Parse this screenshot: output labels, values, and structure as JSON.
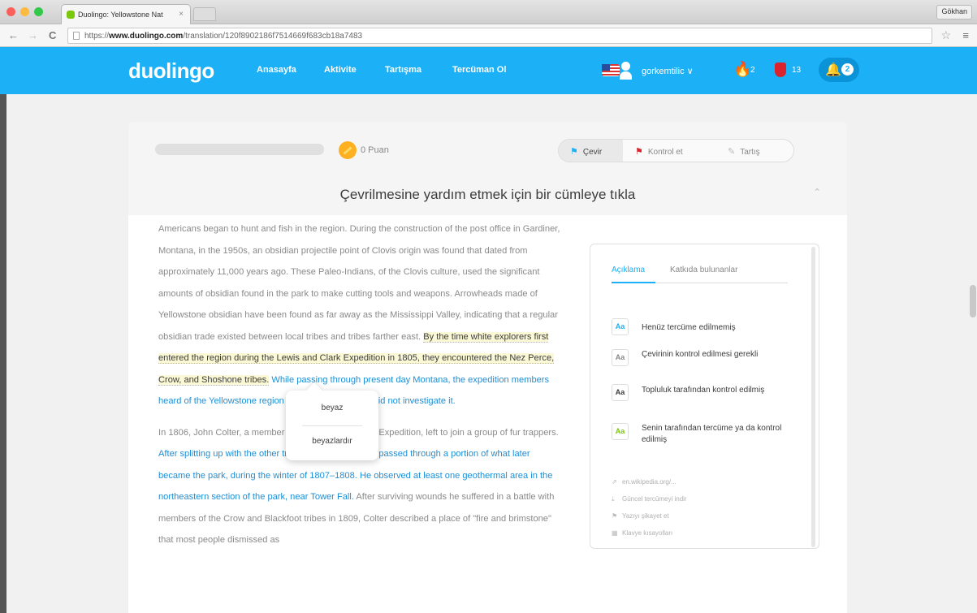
{
  "browser": {
    "tab_title": "Duolingo: Yellowstone Nat",
    "tab_close": "×",
    "profile_button": "Gökhan",
    "url_prefix": "https://",
    "url_domain": "www.duolingo.com",
    "url_path": "/translation/120f8902186f7514669f683cb18a7483",
    "back": "←",
    "forward": "→",
    "reload": "C",
    "star": "☆",
    "menu": "≡"
  },
  "header": {
    "logo": "duolingo",
    "nav": [
      "Anasayfa",
      "Aktivite",
      "Tartışma",
      "Tercüman Ol"
    ],
    "username": "gorkemtilic ∨",
    "streak": "2",
    "lingots": "13",
    "notifications": "2",
    "flame_glyph": "🔥",
    "bell_glyph": "🔔"
  },
  "toolbar": {
    "progress_percent": 0,
    "points": "0 Puan",
    "mode_translate": "Çevir",
    "mode_review": "Kontrol et",
    "mode_discuss": "Tartış",
    "instruction": "Çevrilmesine yardım etmek için bir cümleye tıkla"
  },
  "article": {
    "p1": {
      "s1": "Americans began to hunt and fish in the region.",
      "s2": "During the construction of the post office in Gardiner, Montana, in the 1950s, an obsidian projectile point of Clovis origin was found that dated from approximately 11,000 years ago.",
      "s3": "These Paleo-Indians, of the Clovis culture, used the significant amounts of obsidian found in the park to make cutting tools and weapons.",
      "s4": "Arrowheads made of Yellowstone obsidian have been found as far away as the Mississippi Valley, indicating that a regular obsidian trade existed between local tribes and tribes farther east.",
      "s5": "By the time white explorers first entered the region during the Lewis and Clark Expedition in 1805, they encountered the Nez Perce, Crow, and Shoshone tribes.",
      "s6": "While passing through present day Montana, the expedition members heard of the Yellowstone region to the south, but they did not investigate it."
    },
    "p2": {
      "s1": "In 1806, John Colter, a member of the Lewis and Clark Expedition, left to join a group of fur trappers.",
      "s2": "After splitting up with the other trappers in 1807, Colter passed through a portion of what later became the park, during the winter of 1807–1808.",
      "s3": "He observed at least one geothermal area in the northeastern section of the park, near Tower Fall.",
      "s4": "After surviving wounds he suffered in a battle with members of the Crow and Blackfoot tribes in 1809, Colter described a place of \"fire and brimstone\" that most people dismissed as"
    }
  },
  "popup": {
    "option1": "beyaz",
    "option2": "beyazlardır"
  },
  "side": {
    "tab_active": "Açıklama",
    "tab_other": "Katkıda bulunanlar",
    "legend_glyph": "Aa",
    "legend": [
      {
        "text": "Henüz tercüme edilmemiş",
        "color": "#1cb0f6"
      },
      {
        "text": "Çevirinin kontrol edilmesi gerekli",
        "color": "#888888"
      },
      {
        "text": "Topluluk tarafından kontrol edilmiş",
        "color": "#3c3c3c"
      },
      {
        "text": "Senin tarafından tercüme ya da kontrol edilmiş",
        "color": "#7ac70c"
      }
    ],
    "links": [
      {
        "icon": "⇗",
        "text": "en.wikipedia.org/..."
      },
      {
        "icon": "⤓",
        "text": "Güncel tercümeyi indir"
      },
      {
        "icon": "⚑",
        "text": "Yazıyı şikayet et"
      },
      {
        "icon": "▦",
        "text": "Klavye kısayolları"
      }
    ]
  },
  "colors": {
    "brand_blue": "#1cb0f6",
    "highlight": "#fbf8d6",
    "link_blue": "#1c8fd6"
  }
}
